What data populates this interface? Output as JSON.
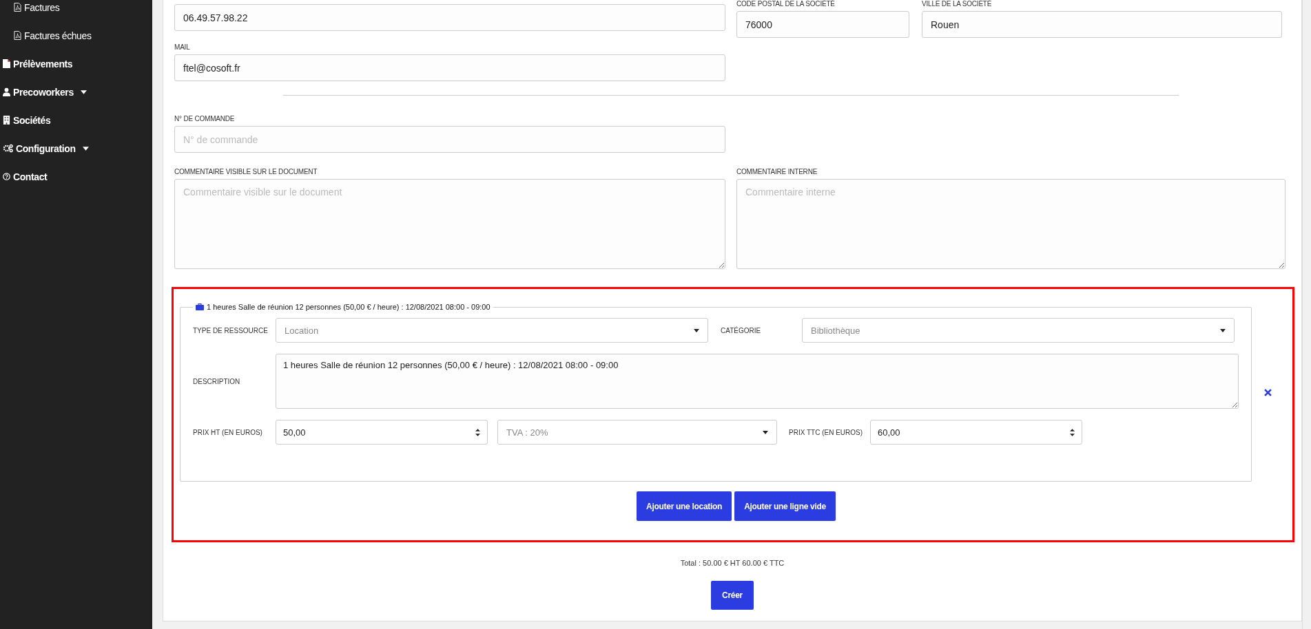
{
  "sidebar": {
    "items": [
      {
        "label": "Factures",
        "kind": "pdf",
        "dropdown": false,
        "sub": true
      },
      {
        "label": "Factures échues",
        "kind": "pdf",
        "dropdown": false,
        "sub": true
      },
      {
        "label": "Prélèvements",
        "kind": "file",
        "dropdown": false,
        "sub": false
      },
      {
        "label": "Precoworkers",
        "kind": "user",
        "dropdown": true,
        "sub": false
      },
      {
        "label": "Sociétés",
        "kind": "building",
        "dropdown": false,
        "sub": false
      },
      {
        "label": "Configuration",
        "kind": "gears",
        "dropdown": true,
        "sub": false
      },
      {
        "label": "Contact",
        "kind": "help",
        "dropdown": false,
        "sub": false
      }
    ]
  },
  "contact": {
    "phone": {
      "value": "06.49.57.98.22"
    },
    "postal_code": {
      "label": "CODE POSTAL DE LA SOCIÉTÉ",
      "value": "76000"
    },
    "city": {
      "label": "VILLE DE LA SOCIÉTÉ",
      "value": "Rouen"
    },
    "mail": {
      "label": "MAIL",
      "value": "ftel@cosoft.fr"
    }
  },
  "order_number": {
    "label": "N° DE COMMANDE",
    "placeholder": "N° de commande"
  },
  "comments": [
    {
      "label": "COMMENTAIRE VISIBLE SUR LE DOCUMENT",
      "placeholder": "Commentaire visible sur le document"
    },
    {
      "label": "COMMENTAIRE INTERNE",
      "placeholder": "Commentaire interne"
    }
  ],
  "line_item": {
    "legend": "1 heures Salle de réunion 12 personnes (50,00 € / heure) : 12/08/2021 08:00 - 09:00",
    "resource_type": {
      "label": "TYPE DE RESSOURCE",
      "value": "Location",
      "disabled": true
    },
    "category": {
      "label": "CATÉGORIE",
      "value": "Bibliothèque",
      "disabled": true
    },
    "description": {
      "label": "DESCRIPTION",
      "value": "1 heures Salle de réunion 12 personnes (50,00 € / heure) : 12/08/2021 08:00 - 09:00"
    },
    "price_ht": {
      "label": "PRIX HT (EN EUROS)",
      "value": "50,00"
    },
    "tva": {
      "value": "TVA : 20%",
      "disabled": true
    },
    "price_ttc": {
      "label": "PRIX TTC (EN EUROS)",
      "value": "60,00"
    }
  },
  "line_buttons": [
    "Ajouter une location",
    "Ajouter une ligne vide"
  ],
  "total": "Total : 50.00 € HT 60.00 € TTC",
  "submit": "Créer"
}
